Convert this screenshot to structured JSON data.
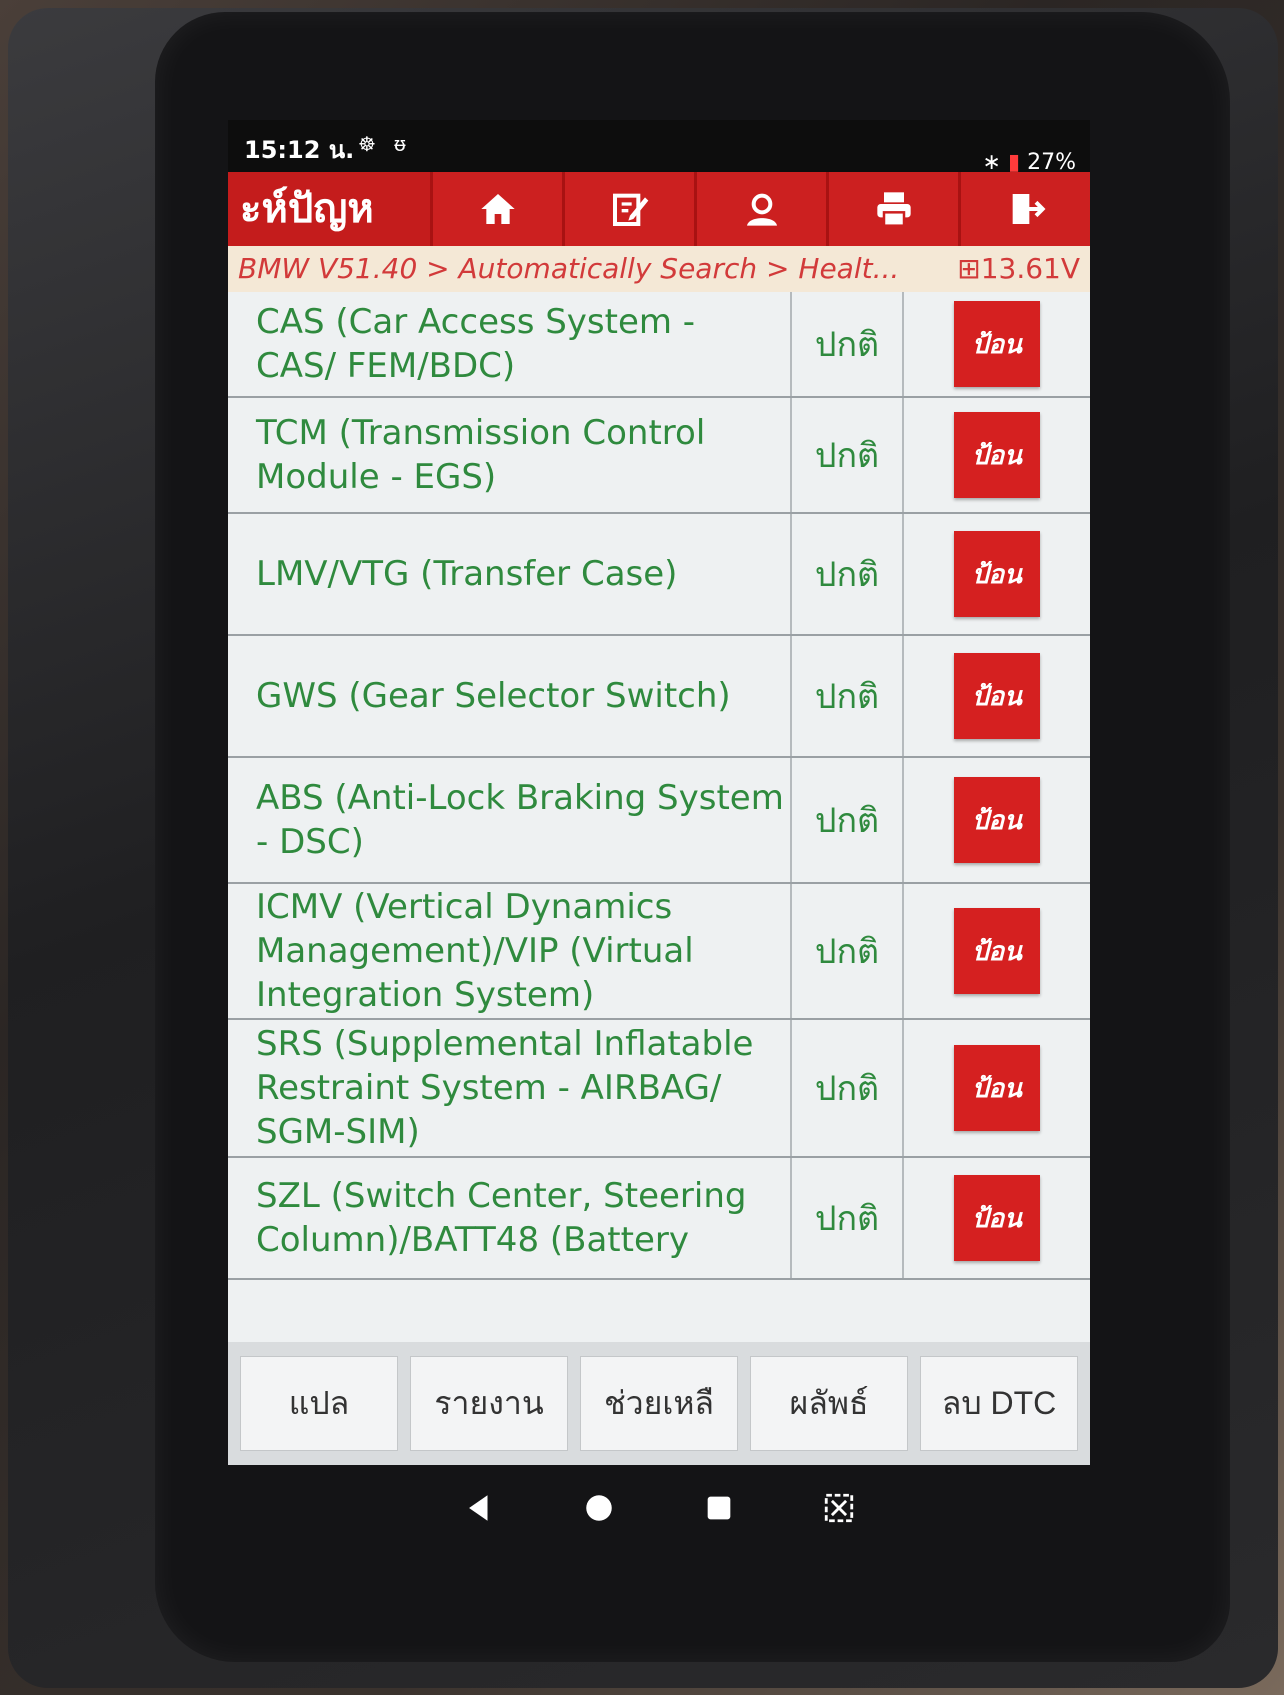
{
  "status_bar": {
    "time": "15:12 น.",
    "left_icons": "☸ ᵿ",
    "bluetooth": "∗",
    "battery": "27%"
  },
  "header": {
    "title": "ะห์ปัญห",
    "buttons": [
      {
        "icon": "home-icon"
      },
      {
        "icon": "edit-note-icon"
      },
      {
        "icon": "user-support-icon"
      },
      {
        "icon": "printer-icon"
      },
      {
        "icon": "exit-icon"
      }
    ]
  },
  "breadcrumb": {
    "path": "BMW V51.40 > Automatically Search > Healt...",
    "voltage": "13.61V"
  },
  "systems": [
    {
      "name": "CAS (Car Access System - CAS/ FEM/BDC)",
      "status": "ปกติ",
      "action": "ป้อน"
    },
    {
      "name": "TCM (Transmission Control Module - EGS)",
      "status": "ปกติ",
      "action": "ป้อน"
    },
    {
      "name": "LMV/VTG (Transfer Case)",
      "status": "ปกติ",
      "action": "ป้อน"
    },
    {
      "name": "GWS (Gear Selector Switch)",
      "status": "ปกติ",
      "action": "ป้อน"
    },
    {
      "name": "ABS (Anti-Lock Braking System - DSC)",
      "status": "ปกติ",
      "action": "ป้อน"
    },
    {
      "name": "ICMV (Vertical Dynamics Management)/VIP (Virtual Integration System)",
      "status": "ปกติ",
      "action": "ป้อน"
    },
    {
      "name": "SRS (Supplemental Inflatable Restraint System - AIRBAG/ SGM-SIM)",
      "status": "ปกติ",
      "action": "ป้อน"
    },
    {
      "name": "SZL (Switch Center, Steering Column)/BATT48 (Battery",
      "status": "ปกติ",
      "action": "ป้อน"
    }
  ],
  "toolbar": {
    "translate": "แปล",
    "report": "รายงาน",
    "help": "ช่วยเหลื",
    "result": "ผลัพธ์",
    "clear_dtc": "ลบ DTC"
  },
  "colors": {
    "header_red": "#c41c1c",
    "button_red": "#d52020",
    "text_green": "#2f8a3e",
    "breadcrumb_bg": "#f4e8d6"
  }
}
